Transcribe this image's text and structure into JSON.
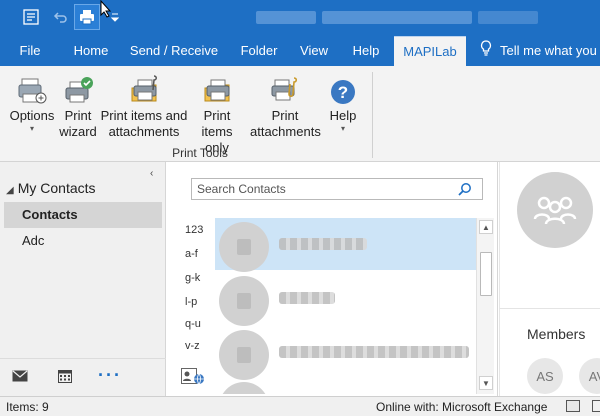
{
  "quick_access": {
    "icons": [
      "send-receive-icon",
      "undo-icon",
      "print-icon",
      "customize-dropdown-icon"
    ]
  },
  "tabs": [
    {
      "label": "File"
    },
    {
      "label": "Home"
    },
    {
      "label": "Send / Receive"
    },
    {
      "label": "Folder"
    },
    {
      "label": "View"
    },
    {
      "label": "Help"
    },
    {
      "label": "MAPILab",
      "active": true
    }
  ],
  "tell_me": "Tell me what you",
  "ribbon": {
    "buttons": [
      {
        "label": "Options",
        "icon": "options-icon",
        "has_dropdown": true
      },
      {
        "label": "Print\nwizard",
        "icon": "print-wizard-icon"
      },
      {
        "label": "Print items and\nattachments",
        "icon": "print-items-attachments-icon"
      },
      {
        "label": "Print\nitems only",
        "icon": "print-items-only-icon"
      },
      {
        "label": "Print\nattachments",
        "icon": "print-attachments-icon"
      },
      {
        "label": "Help",
        "icon": "help-icon",
        "has_dropdown": true
      }
    ],
    "group_label": "Print Tools"
  },
  "nav": {
    "header": "My Contacts",
    "items": [
      {
        "label": "Contacts",
        "selected": true
      },
      {
        "label": "Adc",
        "selected": false
      }
    ]
  },
  "search": {
    "placeholder": "Search Contacts"
  },
  "alpha_index": [
    "123",
    "a-f",
    "g-k",
    "l-p",
    "q-u",
    "v-z"
  ],
  "members": {
    "label": "Members",
    "initials": [
      "AS",
      "AV"
    ]
  },
  "status": {
    "items": "Items: 9",
    "connection": "Online with: Microsoft Exchange"
  },
  "colors": {
    "accent": "#1e6fc4",
    "selected_row": "#cde4f7",
    "ribbon_bg": "#f3f3f3"
  }
}
